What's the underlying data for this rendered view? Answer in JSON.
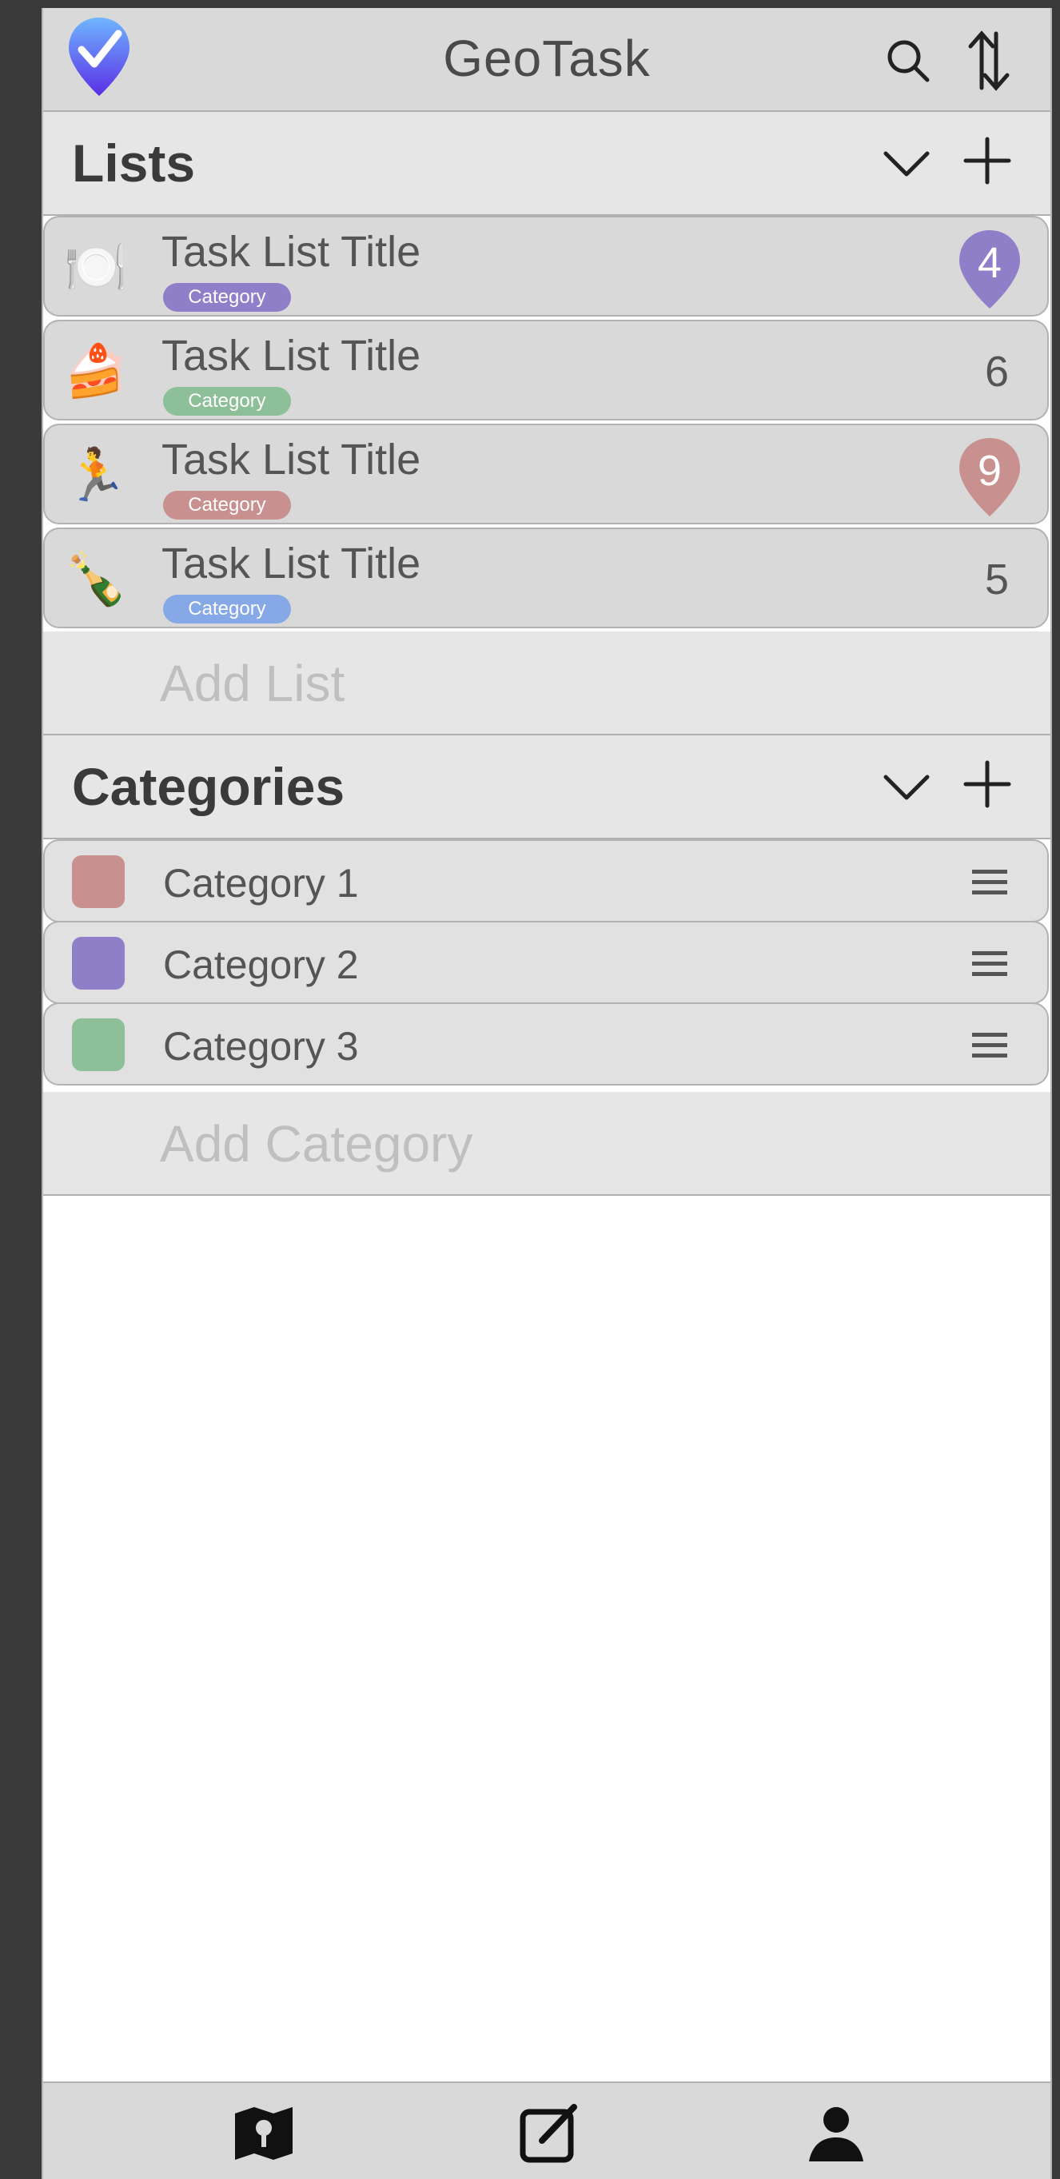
{
  "header": {
    "title": "GeoTask"
  },
  "lists_section": {
    "title": "Lists",
    "add_label": "Add List"
  },
  "lists": [
    {
      "icon": "fork-knife-plate-icon",
      "emoji": "🍽️",
      "title": "Task List Title",
      "category": "Category",
      "category_color": "#8f7fc9",
      "count": "4",
      "pinned": true,
      "pin_color": "#8f7fc9"
    },
    {
      "icon": "cake-icon",
      "emoji": "🍰",
      "title": "Task List Title",
      "category": "Category",
      "category_color": "#8dbf98",
      "count": "6",
      "pinned": false
    },
    {
      "icon": "runner-icon",
      "emoji": "🏃",
      "title": "Task List Title",
      "category": "Category",
      "category_color": "#c99090",
      "count": "9",
      "pinned": true,
      "pin_color": "#c99090"
    },
    {
      "icon": "champagne-icon",
      "emoji": "🍾",
      "title": "Task List Title",
      "category": "Category",
      "category_color": "#86a8e6",
      "count": "5",
      "pinned": false
    }
  ],
  "categories_section": {
    "title": "Categories",
    "add_label": "Add Category"
  },
  "categories": [
    {
      "name": "Category 1",
      "color": "#c99090"
    },
    {
      "name": "Category 2",
      "color": "#8f7fc9"
    },
    {
      "name": "Category 3",
      "color": "#8dbf98"
    }
  ],
  "colors": {
    "logo_top": "#6fb6ff",
    "logo_bottom": "#5a2ee6"
  },
  "nav": [
    {
      "icon": "map-pin-icon"
    },
    {
      "icon": "edit-icon"
    },
    {
      "icon": "profile-icon"
    }
  ]
}
